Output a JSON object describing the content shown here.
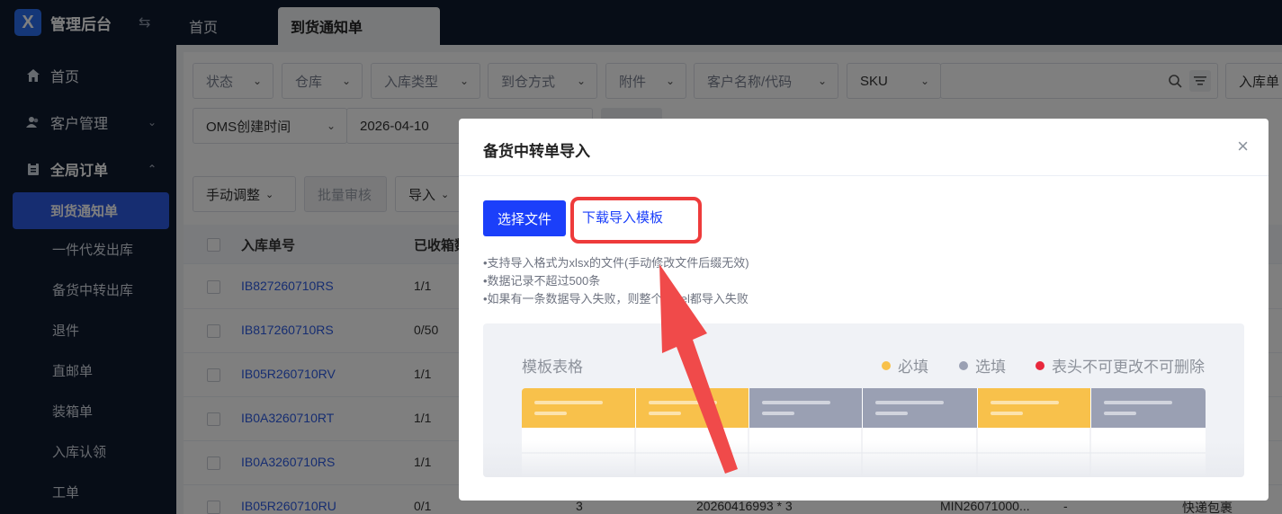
{
  "app": {
    "logo_letter": "X",
    "title": "管理后台",
    "collapse_icon": "⇆"
  },
  "sidebar": {
    "items": [
      {
        "label": "首页",
        "icon": "home-icon"
      },
      {
        "label": "客户管理",
        "icon": "users-icon"
      }
    ],
    "group": {
      "label": "全局订单",
      "icon": "order-icon"
    },
    "sub_items": [
      "到货通知单",
      "一件代发出库",
      "备货中转出库",
      "退件",
      "直邮单",
      "装箱单",
      "入库认领",
      "工单"
    ],
    "active_sub": "到货通知单"
  },
  "tabs": {
    "home": "首页",
    "active": "到货通知单"
  },
  "filters": {
    "row1": [
      "状态",
      "仓库",
      "入库类型",
      "到仓方式",
      "附件",
      "客户名称/代码"
    ],
    "sku_label": "SKU",
    "right_select": "入库单",
    "time_select": "OMS创建时间",
    "date_value": "2026-04-10"
  },
  "toolbar": {
    "manual_adjust": "手动调整",
    "batch_review": "批量审核",
    "import": "导入"
  },
  "table": {
    "headers": [
      "入库单号",
      "已收箱数"
    ],
    "rows": [
      {
        "id": "IB827260710RS",
        "received": "1/1"
      },
      {
        "id": "IB817260710RS",
        "received": "0/50"
      },
      {
        "id": "IB05R260710RV",
        "received": "1/1"
      },
      {
        "id": "IB0A3260710RT",
        "received": "1/1"
      },
      {
        "id": "IB0A3260710RS",
        "received": "1/1"
      },
      {
        "id": "IB05R260710RU",
        "received": "0/1",
        "col3": "3",
        "col4": "20260416993 * 3",
        "col5": "MIN26071000...",
        "col6": "-",
        "col7": "快递包裹"
      }
    ]
  },
  "modal": {
    "title": "备货中转单导入",
    "close": "×",
    "select_file": "选择文件",
    "download_template": "下载导入模板",
    "notes": [
      "•支持导入格式为xlsx的文件(手动修改文件后缀无效)",
      "•数据记录不超过500条",
      "•如果有一条数据导入失败，则整个excel都导入失败"
    ],
    "template": {
      "title": "模板表格",
      "legend": [
        {
          "label": "必填",
          "color": "#f8c14b"
        },
        {
          "label": "选填",
          "color": "#9aa0b3"
        },
        {
          "label": "表头不可更改不可删除",
          "color": "#e8283c"
        }
      ],
      "columns": [
        "required",
        "required",
        "optional",
        "optional",
        "required",
        "optional"
      ]
    }
  },
  "colors": {
    "sidebar_bg": "#0f1a2e",
    "accent": "#2d5be3",
    "primary_button": "#1b3ffa",
    "highlight": "#ee3b3b",
    "required": "#f8c14b",
    "optional": "#9aa0b3"
  }
}
